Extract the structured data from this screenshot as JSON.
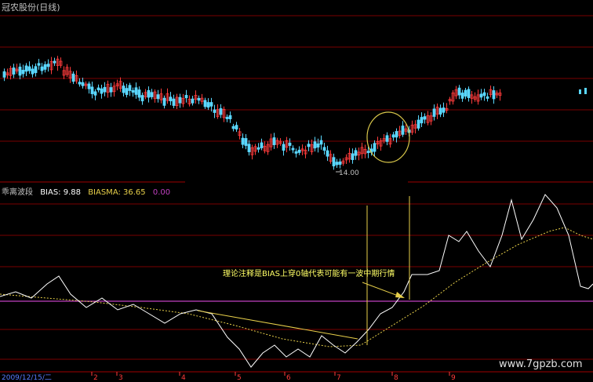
{
  "window": {
    "title": "冠农股份(日线)"
  },
  "main_chart": {
    "low_label": "14.00",
    "colors": {
      "up": "#ff3b3b",
      "down": "#5ad7ff",
      "ma": "#ffffff",
      "grid": "#7a0000"
    }
  },
  "indicator_panel": {
    "name": "乖离波段",
    "bias_label": "BIAS: 9.88",
    "biasma_label": "BIASMA: 36.65",
    "extra_label": "0.00",
    "annotation": "理论注释是BIAS上穿0轴代表可能有一波中期行情",
    "colors": {
      "bias": "#ffffff",
      "biasma": "#e8d04a",
      "zero_axis": "#c040c0",
      "annotation": "#ffff66"
    }
  },
  "time_axis": {
    "start_date": "2009/12/15/二",
    "months": [
      "2",
      "3",
      "4",
      "5",
      "6",
      "7",
      "8",
      "9"
    ],
    "tick_color": "#ff3b3b"
  },
  "watermark": "www.7gpzb.com"
}
